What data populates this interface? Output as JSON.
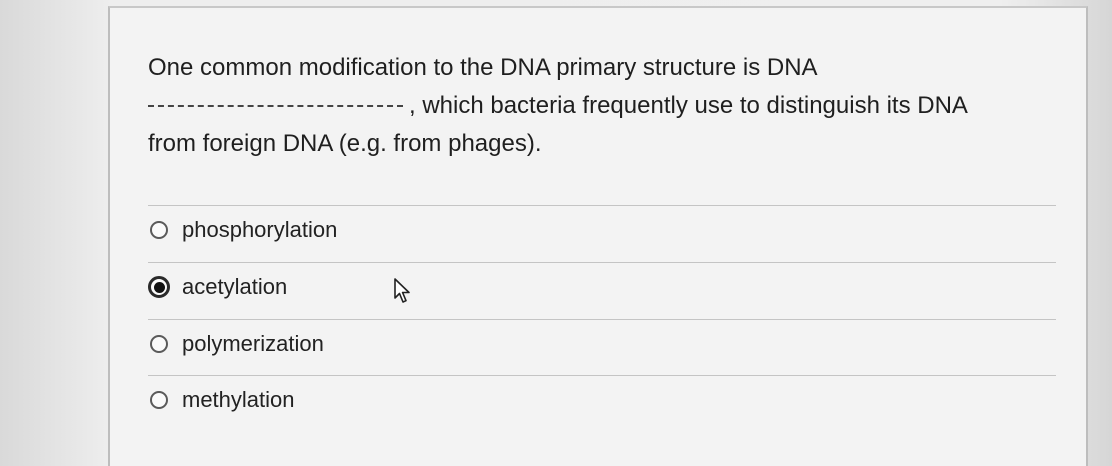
{
  "question": {
    "line1": "One common modification to the DNA primary structure is DNA",
    "line2_suffix": ", which bacteria frequently use to distinguish its DNA",
    "line3": "from foreign DNA (e.g. from phages)."
  },
  "options": [
    {
      "label": "phosphorylation",
      "selected": false
    },
    {
      "label": "acetylation",
      "selected": true
    },
    {
      "label": "polymerization",
      "selected": false
    },
    {
      "label": "methylation",
      "selected": false
    }
  ],
  "icons": {
    "pointer": "mouse-pointer-icon"
  }
}
